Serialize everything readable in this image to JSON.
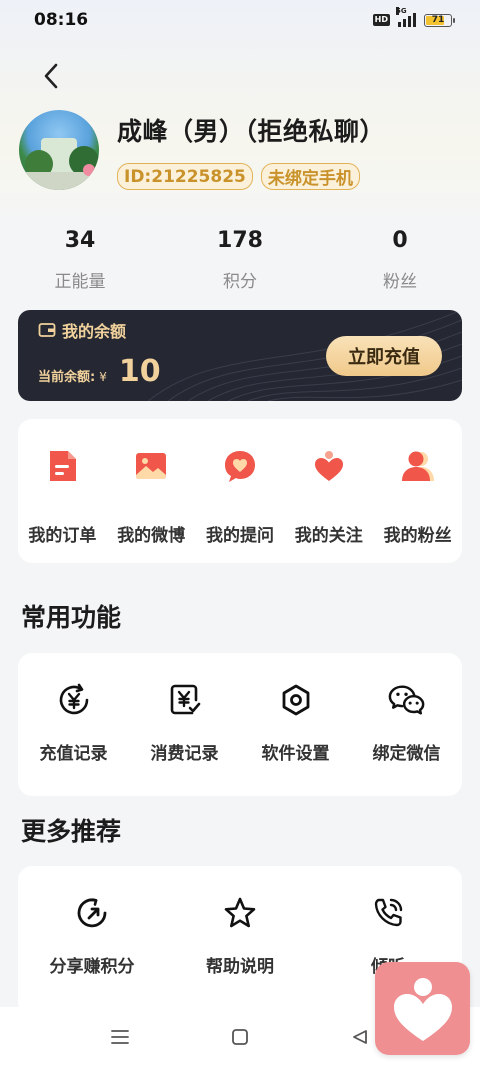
{
  "status_bar": {
    "time": "08:16",
    "hd": "HD",
    "network": "5G",
    "battery": "71"
  },
  "profile": {
    "name": "成峰（男）（拒绝私聊）",
    "id_tag": "ID:21225825",
    "phone_tag": "未绑定手机"
  },
  "stats": [
    {
      "value": "34",
      "label": "正能量"
    },
    {
      "value": "178",
      "label": "积分"
    },
    {
      "value": "0",
      "label": "粉丝"
    }
  ],
  "balance": {
    "title": "我的余额",
    "current_label": "当前余额:",
    "currency": "¥",
    "amount": "10",
    "recharge_button": "立即充值"
  },
  "orders": [
    {
      "label": "我的订单",
      "icon": "document-icon"
    },
    {
      "label": "我的微博",
      "icon": "image-icon"
    },
    {
      "label": "我的提问",
      "icon": "heart-bubble-icon"
    },
    {
      "label": "我的关注",
      "icon": "heart-person-icon"
    },
    {
      "label": "我的粉丝",
      "icon": "user-icon"
    }
  ],
  "common_functions": {
    "title": "常用功能",
    "items": [
      {
        "label": "充值记录",
        "icon": "yuan-refresh-icon"
      },
      {
        "label": "消费记录",
        "icon": "yuan-check-icon"
      },
      {
        "label": "软件设置",
        "icon": "settings-hex-icon"
      },
      {
        "label": "绑定微信",
        "icon": "wechat-icon"
      }
    ]
  },
  "more_recommend": {
    "title": "更多推荐",
    "items": [
      {
        "label": "分享赚积分",
        "icon": "share-refresh-icon"
      },
      {
        "label": "帮助说明",
        "icon": "star-icon"
      },
      {
        "label": "倾听",
        "icon": "phone-call-icon"
      }
    ]
  },
  "colors": {
    "accent_gold": "#e3b257",
    "card_dark": "#252833",
    "order_red": "#f0564a",
    "floating_pink": "#ef8f92"
  }
}
